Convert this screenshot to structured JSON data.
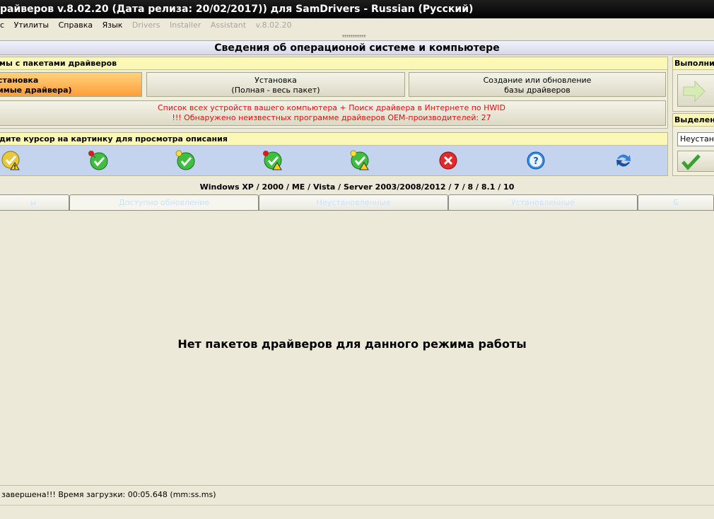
{
  "window": {
    "title": "райверов v.8.02.20 (Дата релиза: 20/02/2017)) для SamDrivers - Russian (Русский)"
  },
  "menu": {
    "items": [
      {
        "label": "с",
        "enabled": true
      },
      {
        "label": "Утилиты",
        "enabled": true
      },
      {
        "label": "Справка",
        "enabled": true
      },
      {
        "label": "Язык",
        "enabled": true
      },
      {
        "label": "Drivers",
        "enabled": false
      },
      {
        "label": "Installer",
        "enabled": false
      },
      {
        "label": "Assistant",
        "enabled": false
      },
      {
        "label": "v.8.02.20",
        "enabled": false
      }
    ]
  },
  "heading": "Сведения об операционой системе и компьютере",
  "packages_panel": {
    "header": "мы с пакетами драйверов",
    "btn_install_line1": "становка",
    "btn_install_line2": "имые драйвера)",
    "btn_full_line1": "Установка",
    "btn_full_line2": "(Полная - весь пакет)",
    "btn_db_line1": "Создание или обновление",
    "btn_db_line2": "базы драйверов",
    "devices_line1": "Список всех устройств вашего компьютера + Поиск драйвера в Интернете по HWID",
    "devices_line2": "!!! Обнаружено неизвестных программе драйверов OEM-производителей: 27"
  },
  "icons_panel": {
    "header": "дите курсор на картинку для просмотра описания",
    "icons": [
      "check-warning-icon",
      "check-pin-icon",
      "check-bulb-icon",
      "check-pin-warning-icon",
      "check-bulb-warning-icon",
      "error-x-icon",
      "help-icon",
      "refresh-icon"
    ]
  },
  "right_panel": {
    "execute_header": "Выполнит",
    "selection_header": "Выделен",
    "selection_value": "Неустано"
  },
  "os_line": "Windows XP / 2000 / ME / Vista / Server 2003/2008/2012 / 7 / 8 / 8.1 / 10",
  "tabs": [
    {
      "label": "ы"
    },
    {
      "label": "Доступно обновление"
    },
    {
      "label": "Неустановленные"
    },
    {
      "label": "Установленные"
    },
    {
      "label": "Б"
    }
  ],
  "main_message": "Нет пакетов драйверов для данного режима работы",
  "status": "завершена!!! Время загрузки: 00:05.648 (mm:ss.ms)",
  "colors": {
    "accent_orange": "#ff9d3a",
    "warning_red": "#e01010",
    "panel_blue": "#c4d4ef",
    "header_yellow": "#fbf7b5"
  }
}
